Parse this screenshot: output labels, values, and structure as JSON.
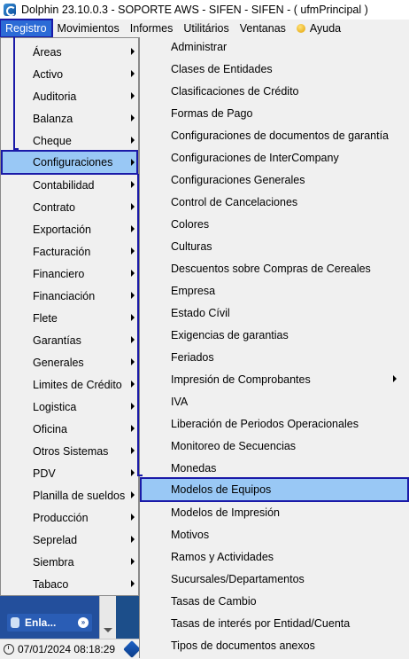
{
  "window": {
    "title": "Dolphin 23.10.0.3 - SOPORTE AWS - SIFEN - SIFEN -  ( ufmPrincipal )"
  },
  "menubar": {
    "items": [
      "Registro",
      "Movimientos",
      "Informes",
      "Utilitários",
      "Ventanas",
      "Ayuda"
    ]
  },
  "registro_menu": {
    "items": [
      "Áreas",
      "Activo",
      "Auditoria",
      "Balanza",
      "Cheque",
      "Configuraciones",
      "Contabilidad",
      "Contrato",
      "Exportación",
      "Facturación",
      "Financiero",
      "Financiación",
      "Flete",
      "Garantías",
      "Generales",
      "Limites de Crédito",
      "Logistica",
      "Oficina",
      "Otros Sistemas",
      "PDV",
      "Planilla de sueldos",
      "Producción",
      "Seprelad",
      "Siembra",
      "Tabaco"
    ]
  },
  "configuraciones_menu": {
    "items": [
      "Administrar",
      "Clases de Entidades",
      "Clasificaciones de Crédito",
      "Formas de Pago",
      "Configuraciones de documentos de garantía",
      "Configuraciones de InterCompany",
      "Configuraciones Generales",
      "Control de Cancelaciones",
      "Colores",
      "Culturas",
      "Descuentos sobre Compras de Cereales",
      "Empresa",
      "Estado Cívil",
      "Exigencias de garantias",
      "Feriados",
      "Impresión de Comprobantes",
      "IVA",
      "Liberación de Periodos Operacionales",
      "Monitoreo de Secuencias",
      "Monedas",
      "Modelos de Equipos",
      "Modelos de Impresión",
      "Motivos",
      "Ramos y Actividades",
      "Sucursales/Departamentos",
      "Tasas de Cambio",
      "Tasas de interés por Entidad/Cuenta",
      "Tipos de documentos anexos"
    ]
  },
  "left_panel": {
    "label": "Enla..."
  },
  "statusbar": {
    "datetime": "07/01/2024 08:18:29"
  }
}
